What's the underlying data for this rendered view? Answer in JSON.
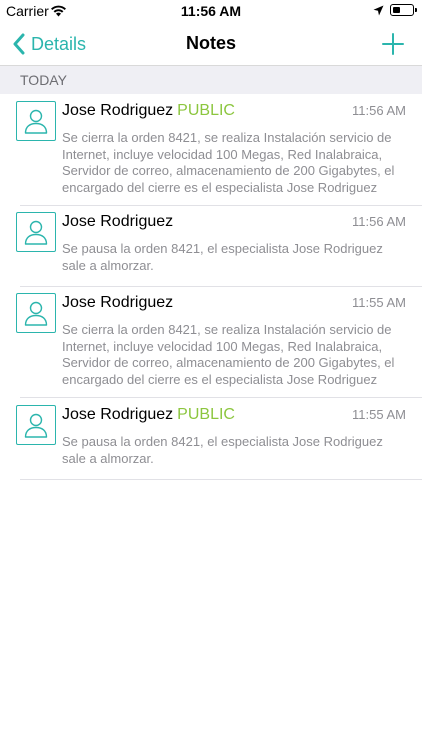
{
  "status_bar": {
    "carrier": "Carrier",
    "time": "11:56 AM"
  },
  "nav": {
    "back_label": "Details",
    "title": "Notes",
    "accent_color": "#2bb5ad"
  },
  "section": {
    "label": "TODAY"
  },
  "notes": [
    {
      "author": "Jose Rodriguez",
      "badge": "PUBLIC",
      "time": "11:56 AM",
      "text": "Se cierra la orden 8421, se realiza Instalación servicio de Internet, incluye velocidad 100 Megas, Red Inalabraica, Servidor de correo, almacenamiento de 200 Gigabytes, el encargado del cierre es el especialista Jose Rodriguez"
    },
    {
      "author": "Jose Rodriguez",
      "badge": "",
      "time": "11:56 AM",
      "text": "Se pausa la orden 8421, el especialista Jose Rodriguez sale a almorzar."
    },
    {
      "author": "Jose Rodriguez",
      "badge": "",
      "time": "11:55 AM",
      "text": "Se cierra la orden 8421, se realiza Instalación servicio de Internet, incluye velocidad 100 Megas, Red Inalabraica, Servidor de correo, almacenamiento de 200 Gigabytes, el encargado del cierre es el especialista Jose Rodriguez"
    },
    {
      "author": "Jose Rodriguez",
      "badge": "PUBLIC",
      "time": "11:55 AM",
      "text": "Se pausa la orden 8421, el especialista Jose Rodriguez sale a almorzar."
    }
  ]
}
